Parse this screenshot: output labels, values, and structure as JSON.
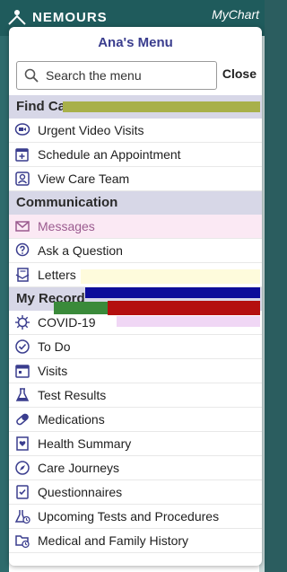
{
  "app": {
    "brand": "NEMOURS",
    "product": "MyChart"
  },
  "menu": {
    "title": "Ana's Menu",
    "search_placeholder": "Search the menu",
    "close_label": "Close"
  },
  "sections": [
    {
      "title": "Find Care",
      "items": [
        {
          "label": "Urgent Video Visits",
          "icon": "video-chat-icon"
        },
        {
          "label": "Schedule an Appointment",
          "icon": "calendar-plus-icon"
        },
        {
          "label": "View Care Team",
          "icon": "care-team-icon"
        }
      ]
    },
    {
      "title": "Communication",
      "items": [
        {
          "label": "Messages",
          "icon": "envelope-icon"
        },
        {
          "label": "Ask a Question",
          "icon": "question-bubble-icon"
        },
        {
          "label": "Letters",
          "icon": "letter-icon"
        }
      ]
    },
    {
      "title": "My Record",
      "items": [
        {
          "label": "COVID-19",
          "icon": "virus-icon"
        },
        {
          "label": "To Do",
          "icon": "checklist-clock-icon"
        },
        {
          "label": "Visits",
          "icon": "calendar-icon"
        },
        {
          "label": "Test Results",
          "icon": "flask-icon"
        },
        {
          "label": "Medications",
          "icon": "pill-icon"
        },
        {
          "label": "Health Summary",
          "icon": "health-summary-icon"
        },
        {
          "label": "Care Journeys",
          "icon": "compass-icon"
        },
        {
          "label": "Questionnaires",
          "icon": "questionnaire-icon"
        },
        {
          "label": "Upcoming Tests and Procedures",
          "icon": "flask-clock-icon"
        },
        {
          "label": "Medical and Family History",
          "icon": "folder-clock-icon"
        }
      ]
    }
  ],
  "colors": {
    "header_bg": "#1f5b5c",
    "title_text": "#3a3d8e",
    "section_bg": "#d7d7e7"
  }
}
